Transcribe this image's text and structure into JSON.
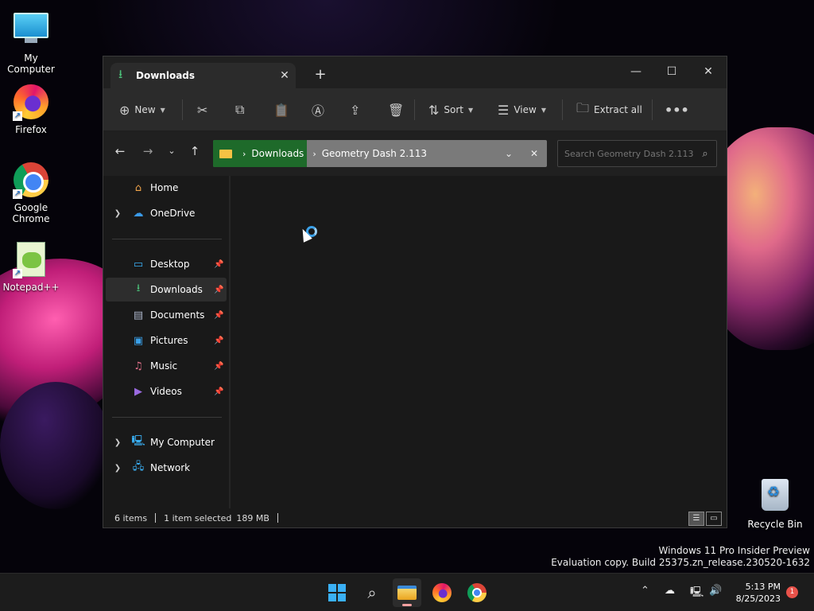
{
  "desktop": {
    "icons": [
      {
        "label": "My Computer"
      },
      {
        "label": "Firefox"
      },
      {
        "label": "Google Chrome"
      },
      {
        "label": "Notepad++"
      },
      {
        "label": "Recycle Bin"
      }
    ]
  },
  "explorer": {
    "tab": {
      "label": "Downloads"
    },
    "toolbar": {
      "new_label": "New",
      "sort_label": "Sort",
      "view_label": "View",
      "extract_label": "Extract all"
    },
    "address": {
      "crumbs": [
        "Downloads",
        "Geometry Dash 2.113"
      ]
    },
    "search": {
      "placeholder": "Search Geometry Dash 2.113"
    },
    "nav": {
      "home": "Home",
      "onedrive": "OneDrive",
      "desktop": "Desktop",
      "downloads": "Downloads",
      "documents": "Documents",
      "pictures": "Pictures",
      "music": "Music",
      "videos": "Videos",
      "my_computer": "My Computer",
      "network": "Network"
    },
    "status": {
      "items": "6 items",
      "selected": "1 item selected",
      "size": "189 MB"
    }
  },
  "watermark": {
    "line1": "Windows 11 Pro Insider Preview",
    "line2": "Evaluation copy. Build 25375.zn_release.230520-1632"
  },
  "taskbar": {
    "time": "5:13 PM",
    "date": "8/25/2023",
    "notification_count": "1"
  },
  "colors": {
    "accent": "#3ab0f5",
    "address_selection": "#1e6a2a",
    "download_icon": "#4cc27a"
  }
}
